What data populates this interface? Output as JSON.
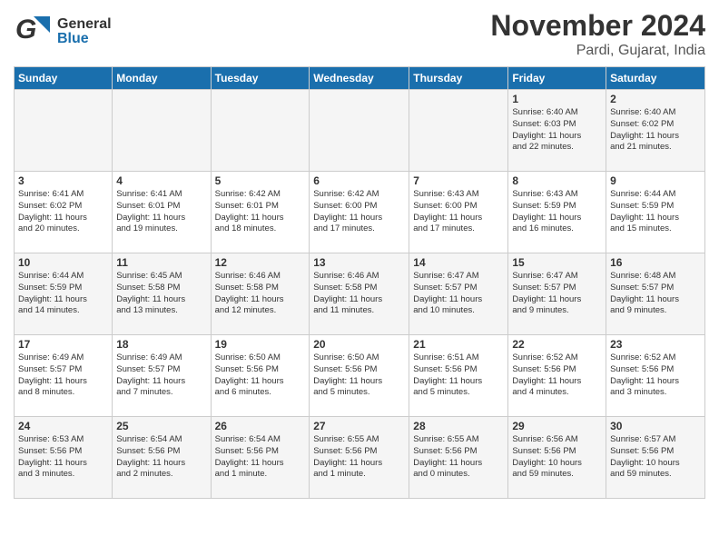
{
  "header": {
    "logo_general": "General",
    "logo_blue": "Blue",
    "month_year": "November 2024",
    "location": "Pardi, Gujarat, India"
  },
  "calendar": {
    "headers": [
      "Sunday",
      "Monday",
      "Tuesday",
      "Wednesday",
      "Thursday",
      "Friday",
      "Saturday"
    ],
    "weeks": [
      [
        {
          "day": "",
          "info": ""
        },
        {
          "day": "",
          "info": ""
        },
        {
          "day": "",
          "info": ""
        },
        {
          "day": "",
          "info": ""
        },
        {
          "day": "",
          "info": ""
        },
        {
          "day": "1",
          "info": "Sunrise: 6:40 AM\nSunset: 6:03 PM\nDaylight: 11 hours\nand 22 minutes."
        },
        {
          "day": "2",
          "info": "Sunrise: 6:40 AM\nSunset: 6:02 PM\nDaylight: 11 hours\nand 21 minutes."
        }
      ],
      [
        {
          "day": "3",
          "info": "Sunrise: 6:41 AM\nSunset: 6:02 PM\nDaylight: 11 hours\nand 20 minutes."
        },
        {
          "day": "4",
          "info": "Sunrise: 6:41 AM\nSunset: 6:01 PM\nDaylight: 11 hours\nand 19 minutes."
        },
        {
          "day": "5",
          "info": "Sunrise: 6:42 AM\nSunset: 6:01 PM\nDaylight: 11 hours\nand 18 minutes."
        },
        {
          "day": "6",
          "info": "Sunrise: 6:42 AM\nSunset: 6:00 PM\nDaylight: 11 hours\nand 17 minutes."
        },
        {
          "day": "7",
          "info": "Sunrise: 6:43 AM\nSunset: 6:00 PM\nDaylight: 11 hours\nand 17 minutes."
        },
        {
          "day": "8",
          "info": "Sunrise: 6:43 AM\nSunset: 5:59 PM\nDaylight: 11 hours\nand 16 minutes."
        },
        {
          "day": "9",
          "info": "Sunrise: 6:44 AM\nSunset: 5:59 PM\nDaylight: 11 hours\nand 15 minutes."
        }
      ],
      [
        {
          "day": "10",
          "info": "Sunrise: 6:44 AM\nSunset: 5:59 PM\nDaylight: 11 hours\nand 14 minutes."
        },
        {
          "day": "11",
          "info": "Sunrise: 6:45 AM\nSunset: 5:58 PM\nDaylight: 11 hours\nand 13 minutes."
        },
        {
          "day": "12",
          "info": "Sunrise: 6:46 AM\nSunset: 5:58 PM\nDaylight: 11 hours\nand 12 minutes."
        },
        {
          "day": "13",
          "info": "Sunrise: 6:46 AM\nSunset: 5:58 PM\nDaylight: 11 hours\nand 11 minutes."
        },
        {
          "day": "14",
          "info": "Sunrise: 6:47 AM\nSunset: 5:57 PM\nDaylight: 11 hours\nand 10 minutes."
        },
        {
          "day": "15",
          "info": "Sunrise: 6:47 AM\nSunset: 5:57 PM\nDaylight: 11 hours\nand 9 minutes."
        },
        {
          "day": "16",
          "info": "Sunrise: 6:48 AM\nSunset: 5:57 PM\nDaylight: 11 hours\nand 9 minutes."
        }
      ],
      [
        {
          "day": "17",
          "info": "Sunrise: 6:49 AM\nSunset: 5:57 PM\nDaylight: 11 hours\nand 8 minutes."
        },
        {
          "day": "18",
          "info": "Sunrise: 6:49 AM\nSunset: 5:57 PM\nDaylight: 11 hours\nand 7 minutes."
        },
        {
          "day": "19",
          "info": "Sunrise: 6:50 AM\nSunset: 5:56 PM\nDaylight: 11 hours\nand 6 minutes."
        },
        {
          "day": "20",
          "info": "Sunrise: 6:50 AM\nSunset: 5:56 PM\nDaylight: 11 hours\nand 5 minutes."
        },
        {
          "day": "21",
          "info": "Sunrise: 6:51 AM\nSunset: 5:56 PM\nDaylight: 11 hours\nand 5 minutes."
        },
        {
          "day": "22",
          "info": "Sunrise: 6:52 AM\nSunset: 5:56 PM\nDaylight: 11 hours\nand 4 minutes."
        },
        {
          "day": "23",
          "info": "Sunrise: 6:52 AM\nSunset: 5:56 PM\nDaylight: 11 hours\nand 3 minutes."
        }
      ],
      [
        {
          "day": "24",
          "info": "Sunrise: 6:53 AM\nSunset: 5:56 PM\nDaylight: 11 hours\nand 3 minutes."
        },
        {
          "day": "25",
          "info": "Sunrise: 6:54 AM\nSunset: 5:56 PM\nDaylight: 11 hours\nand 2 minutes."
        },
        {
          "day": "26",
          "info": "Sunrise: 6:54 AM\nSunset: 5:56 PM\nDaylight: 11 hours\nand 1 minute."
        },
        {
          "day": "27",
          "info": "Sunrise: 6:55 AM\nSunset: 5:56 PM\nDaylight: 11 hours\nand 1 minute."
        },
        {
          "day": "28",
          "info": "Sunrise: 6:55 AM\nSunset: 5:56 PM\nDaylight: 11 hours\nand 0 minutes."
        },
        {
          "day": "29",
          "info": "Sunrise: 6:56 AM\nSunset: 5:56 PM\nDaylight: 10 hours\nand 59 minutes."
        },
        {
          "day": "30",
          "info": "Sunrise: 6:57 AM\nSunset: 5:56 PM\nDaylight: 10 hours\nand 59 minutes."
        }
      ]
    ]
  }
}
